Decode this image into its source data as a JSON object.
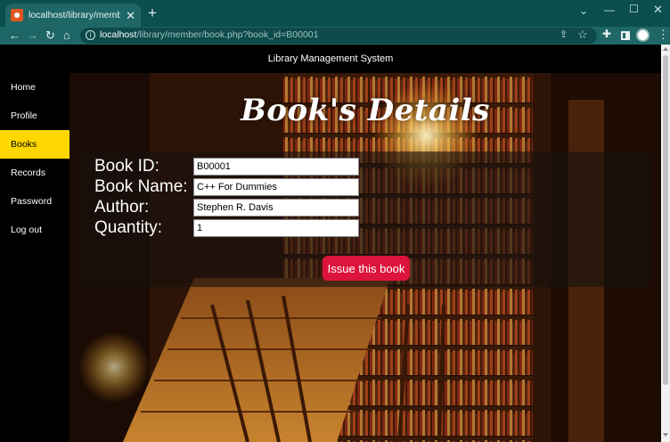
{
  "browser": {
    "tab_title": "localhost/library/member/book.php?book_id=B00001",
    "new_tab": "+",
    "url_host": "localhost",
    "url_path": "/library/member/book.php?book_id=B00001"
  },
  "page": {
    "header_title": "Library Management System",
    "heading": "Book's Details"
  },
  "sidebar": {
    "items": [
      {
        "label": "Home"
      },
      {
        "label": "Profile"
      },
      {
        "label": "Books",
        "active": true
      },
      {
        "label": "Records"
      },
      {
        "label": "Password"
      },
      {
        "label": "Log out"
      }
    ]
  },
  "form": {
    "book_id": {
      "label": "Book ID:",
      "value": "B00001"
    },
    "book_name": {
      "label": "Book Name:",
      "value": "C++ For Dummies"
    },
    "author": {
      "label": "Author:",
      "value": "Stephen R. Davis"
    },
    "quantity": {
      "label": "Quantity:",
      "value": "1"
    },
    "issue_button": "Issue this book"
  },
  "colors": {
    "chrome": "#1f6666",
    "active_nav": "#ffd700",
    "issue_button": "#dc143c"
  }
}
